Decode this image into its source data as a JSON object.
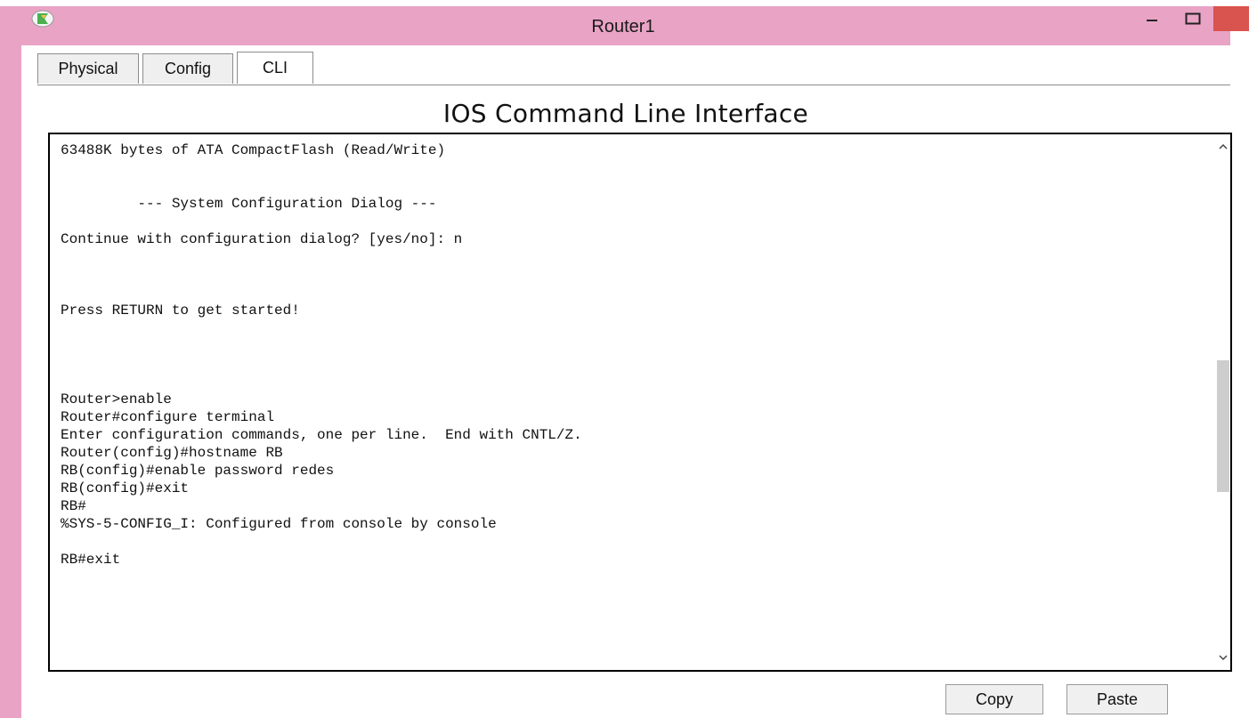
{
  "window": {
    "title": "Router1",
    "icon": "packet-tracer-icon"
  },
  "tabs": [
    {
      "label": "Physical",
      "active": false
    },
    {
      "label": "Config",
      "active": false
    },
    {
      "label": "CLI",
      "active": true
    }
  ],
  "cli": {
    "heading": "IOS Command Line Interface",
    "lines": [
      "63488K bytes of ATA CompactFlash (Read/Write)",
      "",
      "",
      "         --- System Configuration Dialog ---",
      "",
      "Continue with configuration dialog? [yes/no]: n",
      "",
      "",
      "",
      "Press RETURN to get started!",
      "",
      "",
      "",
      "",
      "Router>enable",
      "Router#configure terminal",
      "Enter configuration commands, one per line.  End with CNTL/Z.",
      "Router(config)#hostname RB",
      "RB(config)#enable password redes",
      "RB(config)#exit",
      "RB#",
      "%SYS-5-CONFIG_I: Configured from console by console",
      "",
      "RB#exit"
    ]
  },
  "buttons": {
    "copy": "Copy",
    "paste": "Paste"
  },
  "colors": {
    "titlebar": "#e9a3c5",
    "close": "#d9534f"
  }
}
